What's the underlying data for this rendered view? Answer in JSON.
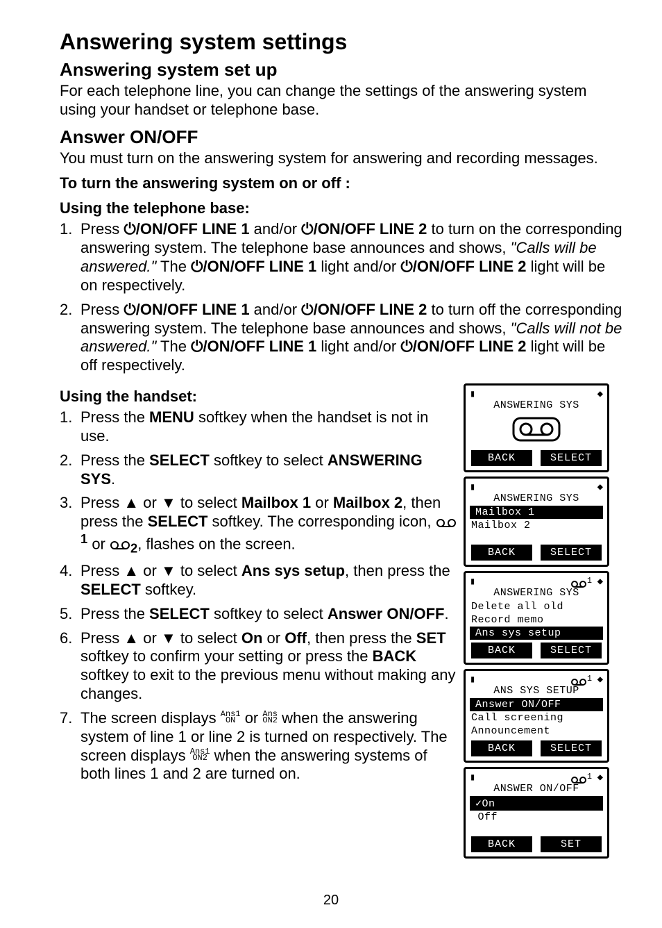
{
  "page": {
    "title": "Answering system settings",
    "number": "20"
  },
  "setup": {
    "heading": "Answering system set up",
    "body": "For each telephone line, you can change the settings of the answering system using your handset or telephone base."
  },
  "onoff": {
    "heading": "Answer ON/OFF",
    "body": "You must turn on the answering system for answering and recording messages.",
    "subheading1": "To turn the answering system on or off :",
    "subheading2": "Using the telephone base:",
    "step1_a": "Press ",
    "step1_b": "/ON/OFF LINE 1",
    "step1_c": " and/or ",
    "step1_d": "/ON/OFF LINE 2",
    "step1_e": " to turn on the corresponding answering system. The telephone base announces and shows, ",
    "step1_f": "\"Calls will be answered.\"",
    "step1_g": "  The ",
    "step1_h": "/ON/OFF LINE 1",
    "step1_i": " light and/or ",
    "step1_j": "/ON/OFF LINE 2",
    "step1_k": " light will be on respectively.",
    "step2_a": "Press ",
    "step2_b": "/ON/OFF LINE 1",
    "step2_c": " and/or ",
    "step2_d": "/ON/OFF LINE 2",
    "step2_e": " to turn off the corresponding answering system. The telephone base announces and shows, ",
    "step2_f": "\"Calls will not be answered.\"",
    "step2_g": " The ",
    "step2_h": "/ON/OFF LINE 1",
    "step2_i": " light and/or ",
    "step2_j": "/ON/OFF LINE 2",
    "step2_k": " light will be off respectively."
  },
  "handset": {
    "heading": "Using the handset:",
    "s1_a": "Press the ",
    "s1_b": "MENU",
    "s1_c": " softkey when the handset is not in use.",
    "s2_a": "Press the ",
    "s2_b": "SELECT",
    "s2_c": " softkey to select ",
    "s2_d": "ANSWERING SYS",
    "s2_e": ".",
    "s3_a": "Press ",
    "s3_b": " or ",
    "s3_c": " to select ",
    "s3_d": "Mailbox 1",
    "s3_e": " or ",
    "s3_f": "Mailbox 2",
    "s3_g": ", then press the ",
    "s3_h": "SELECT",
    "s3_i": " softkey. The corresponding icon, ",
    "s3_j1": "1",
    "s3_j2": " or ",
    "s3_j3": "2",
    "s3_j4": ", flashes on the screen.",
    "s4_a": "Press ",
    "s4_b": " or ",
    "s4_c": " to select ",
    "s4_d": "Ans sys setup",
    "s4_e": ", then press the ",
    "s4_f": "SELECT",
    "s4_g": " softkey.",
    "s5_a": "Press the ",
    "s5_b": "SELECT",
    "s5_c": " softkey to select ",
    "s5_d": "Answer ON/OFF",
    "s5_e": ".",
    "s6_a": "Press ",
    "s6_b": " or ",
    "s6_c": " to select ",
    "s6_d": "On",
    "s6_e": " or ",
    "s6_f": "Off",
    "s6_g": ", then press the ",
    "s6_h": "SET",
    "s6_i": " softkey to confirm your setting or press the ",
    "s6_j": "BACK",
    "s6_k": " softkey to exit to the previous menu without making any changes.",
    "s7_a": "The screen displays ",
    "s7_b": " or ",
    "s7_c": " when the answering system of line 1 or line 2 is turned on respectively. The screen displays ",
    "s7_d": " when the answering systems    of both lines 1 and 2 are turned on.",
    "mini1_top": "Ans1",
    "mini1_bot": "ON",
    "mini2_top": "Ans",
    "mini2_bot": "ON2",
    "mini3_top": "Ans1",
    "mini3_bot": "ON2"
  },
  "screens": {
    "s1": {
      "title": "ANSWERING SYS",
      "back": "BACK",
      "select": "SELECT"
    },
    "s2": {
      "title": "ANSWERING SYS",
      "l1": "Mailbox 1",
      "l2": "Mailbox 2",
      "back": "BACK",
      "select": "SELECT"
    },
    "s3": {
      "title": "ANSWERING SYS",
      "l1": "Delete all old",
      "l2": "Record memo",
      "l3": "Ans sys setup",
      "back": "BACK",
      "select": "SELECT",
      "sup": "1"
    },
    "s4": {
      "title": "ANS SYS SETUP",
      "l1": "Answer ON/OFF",
      "l2": "Call screening",
      "l3": "Announcement",
      "back": "BACK",
      "select": "SELECT",
      "sup": "1"
    },
    "s5": {
      "title": "ANSWER ON/OFF",
      "l1": "✓On",
      "l2": " Off",
      "back": "BACK",
      "select": "SET",
      "sup": "1"
    }
  }
}
